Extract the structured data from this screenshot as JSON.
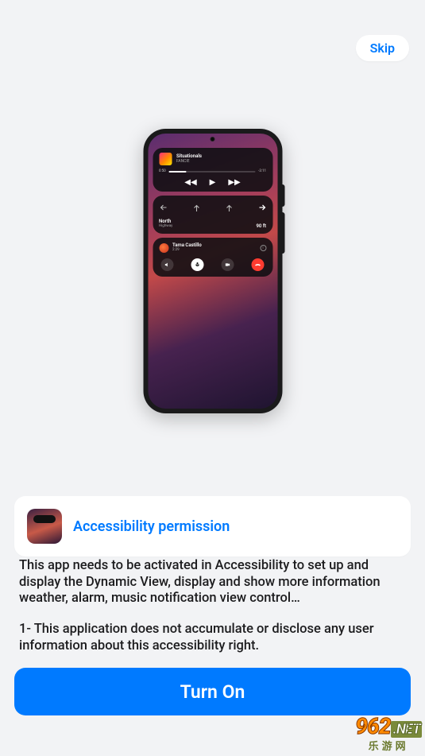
{
  "skip_label": "Skip",
  "preview": {
    "music": {
      "title": "Situationals",
      "artist": "FANCIE",
      "elapsed": "0:50",
      "remaining": "-3:11"
    },
    "nav": {
      "direction": "North",
      "road": "Highway",
      "distance": "90 ft"
    },
    "call": {
      "name": "Tama Castillo",
      "time": "2:29"
    }
  },
  "permission": {
    "title": "Accessibility permission",
    "body1": "This app needs to be activated in Accessibility to set up and display the Dynamic View, display and show more information weather, alarm, music notification view control…",
    "body2": "1- This application does not accumulate or disclose any user information about this accessibility right."
  },
  "cta_label": "Turn On",
  "watermark": {
    "site": "962",
    "tld": ".NET",
    "cn": "乐游网"
  },
  "colors": {
    "accent": "#007aff",
    "danger": "#ff3b30"
  }
}
